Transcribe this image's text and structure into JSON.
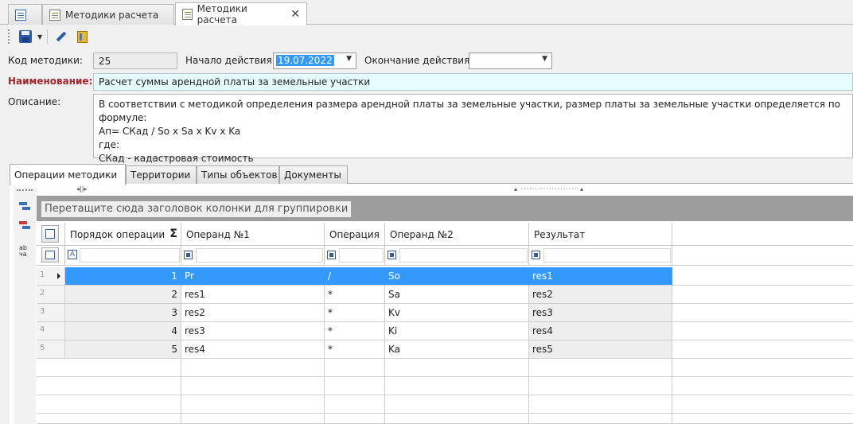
{
  "doc_tabs": [
    {
      "label": ""
    },
    {
      "label": "Методики расчета"
    },
    {
      "label": "Методики расчета",
      "close": "✕"
    }
  ],
  "form": {
    "code_label": "Код методики:",
    "code_value": "25",
    "start_label": "Начало действия:",
    "start_value": "19.07.2022",
    "end_label": "Окончание действия:",
    "end_value": "",
    "name_label": "Наименование:",
    "name_value": "Расчет суммы арендной платы за земельные участки",
    "desc_label": "Описание:",
    "desc_lines": [
      "В соответствии с методикой определения размера арендной платы за земельные участки, размер платы за земельные участки определяется по формуле:",
      "Ап= СКад / So x Sa x Kv x Ka",
      "где:",
      "СКад - кадастровая стоимость"
    ]
  },
  "detail_tabs": [
    "Операции методики",
    "Территории",
    "Типы объектов",
    "Документы"
  ],
  "grid": {
    "group_hint": "Перетащите сюда заголовок колонки для группировки",
    "sum_glyph": "Σ",
    "filter_A": "A",
    "columns": [
      "Порядок операции",
      "Операнд №1",
      "Операция",
      "Операнд №2",
      "Результат"
    ],
    "rows": [
      {
        "n": "1",
        "order": "1",
        "op1": "Pr",
        "op": "/",
        "op2": "So",
        "res": "res1"
      },
      {
        "n": "2",
        "order": "2",
        "op1": "res1",
        "op": "*",
        "op2": "Sa",
        "res": "res2"
      },
      {
        "n": "3",
        "order": "3",
        "op1": "res2",
        "op": "*",
        "op2": "Kv",
        "res": "res3"
      },
      {
        "n": "4",
        "order": "4",
        "op1": "res3",
        "op": "*",
        "op2": "Ki",
        "res": "res4"
      },
      {
        "n": "5",
        "order": "5",
        "op1": "res4",
        "op": "*",
        "op2": "Ka",
        "res": "res5"
      }
    ]
  },
  "side": {
    "abc_label": "ab\nчас"
  },
  "colors": {
    "accent": "#3399ff",
    "label_red": "#a4262c",
    "name_bg": "#e6fbfe"
  }
}
